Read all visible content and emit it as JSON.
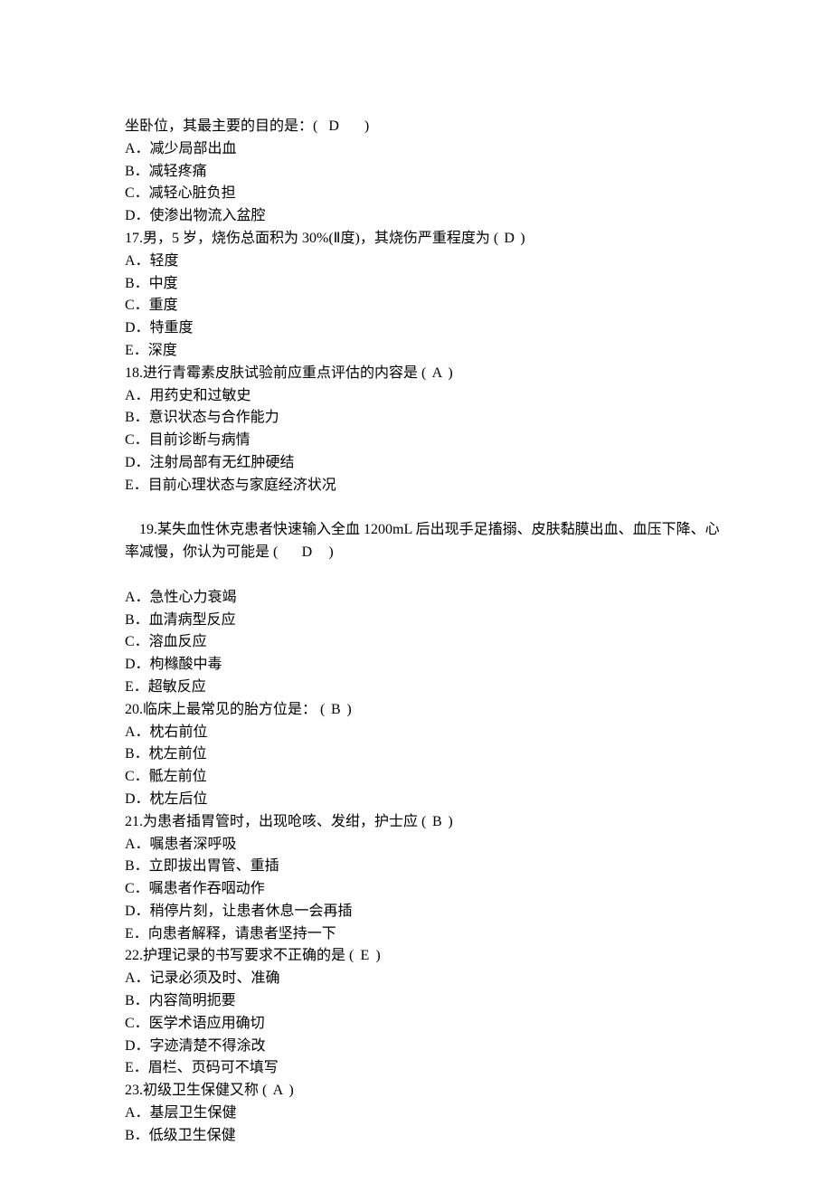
{
  "lead_line": "坐卧位，其最主要的目的是：(   D       )",
  "lead_options": [
    "A．减少局部出血",
    "B．减轻疼痛",
    "C．减轻心脏负担",
    "D．使渗出物流入盆腔"
  ],
  "questions": [
    {
      "num": "17",
      "stem": "男，5 岁，烧伤总面积为 30%(Ⅱ度)，其烧伤严重程度为",
      "answer": "D",
      "options": [
        "A．轻度",
        "B．中度",
        "C．重度",
        "D．特重度",
        "E．深度"
      ]
    },
    {
      "num": "18",
      "stem": "进行青霉素皮肤试验前应重点评估的内容是",
      "answer": "A",
      "options": [
        "A．用药史和过敏史",
        "B．意识状态与合作能力",
        "C．目前诊断与病情",
        "D．注射局部有无红肿硬结",
        "E．目前心理状态与家庭经济状况"
      ]
    },
    {
      "num": "19",
      "stem": "某失血性休克患者快速输入全血 1200mL 后出现手足搐搦、皮肤黏膜出血、血压下降、心率减慢，你认为可能是",
      "answer": "D",
      "options": [
        "A．急性心力衰竭",
        "B．血清病型反应",
        "C．溶血反应",
        "D．枸橼酸中毒",
        "E．超敏反应"
      ]
    },
    {
      "num": "20",
      "stem": "临床上最常见的胎方位是：",
      "answer": "B",
      "options": [
        "A．枕右前位",
        "B．枕左前位",
        "C．骶左前位",
        "D．枕左后位"
      ]
    },
    {
      "num": "21",
      "stem": "为患者插胃管时，出现呛咳、发绀，护士应",
      "answer": "B",
      "options": [
        "A．嘱患者深呼吸",
        "B．立即拔出胃管、重插",
        "C．嘱患者作吞咽动作",
        "D．稍停片刻，让患者休息一会再插",
        "E．向患者解释，请患者坚持一下"
      ]
    },
    {
      "num": "22",
      "stem": "护理记录的书写要求不正确的是",
      "answer": "E",
      "options": [
        "A．记录必须及时、准确",
        "B．内容简明扼要",
        "C．医学术语应用确切",
        "D．字迹清楚不得涂改",
        "E．眉栏、页码可不填写"
      ]
    },
    {
      "num": "23",
      "stem": "初级卫生保健又称",
      "answer": "A",
      "options": [
        "A．基层卫生保健",
        "B．低级卫生保健"
      ]
    }
  ]
}
